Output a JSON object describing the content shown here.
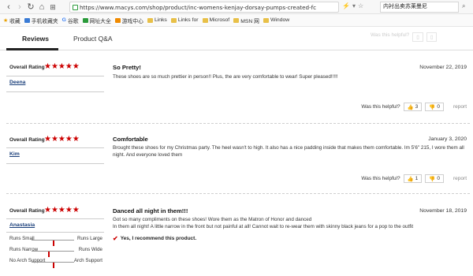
{
  "browser": {
    "url": "https://www.macys.com/shop/product/inc-womens-kenjay-dorsay-pumps-created-fc",
    "search_text": "内衬出卖苏莱曼尼"
  },
  "bookmarks": [
    "收藏",
    "手机收藏夹",
    "谷歌",
    "网址大全",
    "游戏中心",
    "Links",
    "Links for",
    "Microsof",
    "MSN 网",
    "Window"
  ],
  "tabs": {
    "reviews": "Reviews",
    "qa": "Product Q&A"
  },
  "ghost": {
    "helpful": "Was this helpful?"
  },
  "labels": {
    "overall_rating": "Overall Rating",
    "helpful": "Was this helpful?",
    "report": "report"
  },
  "reviews": [
    {
      "user": "Deena",
      "stars": "★★★★★",
      "title": "So Pretty!",
      "date": "November 22, 2019",
      "body": "These shoes are so much prettier in person!! Plus, the are very comfortable to wear! Super pleased!!!!!",
      "up": "3",
      "down": "0"
    },
    {
      "user": "Kim",
      "stars": "★★★★★",
      "title": "Comfortable",
      "date": "January 3, 2020",
      "body": "Brought these shoes for my Christmas party. The heel wasn't to high. It also has a nice padding inside that makes them comfortable. Im 5'6\" 215, I wore them all night. And everyone loved them",
      "up": "1",
      "down": "0"
    },
    {
      "user": "Anastasia",
      "stars": "★★★★★",
      "title": "Danced all night in them!!!",
      "date": "November 18, 2019",
      "body_line1": "Got so many compliments on these shoes! Wore them as the Matron of Honor and danced",
      "body_line2": "In them all night! A little narrow in the front but not painful at all! Cannot wait to re-wear them with skinny black jeans for a pop to the outfit",
      "recommend": "Yes, I recommend this product.",
      "fit": [
        {
          "left": "Runs Small",
          "right": "Runs Large",
          "value": 0.5
        },
        {
          "left": "Runs Narrow",
          "right": "Runs Wide",
          "value": 0.38
        },
        {
          "left": "No Arch Support",
          "right": "Arch Support",
          "value": 0.5
        }
      ]
    }
  ],
  "colors": {
    "star": "#cc0000",
    "user_link": "#1a3f7a"
  }
}
